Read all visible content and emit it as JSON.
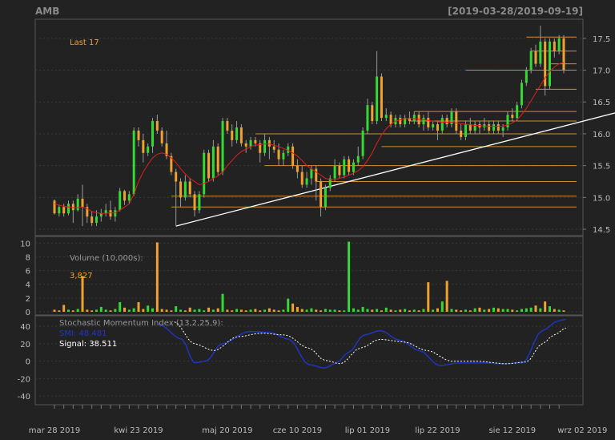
{
  "title": "AMB",
  "date_range": "[2019-03-28/2019-09-19]",
  "colors": {
    "background": "#222222",
    "grid": "#3a3a3a",
    "up": "#35d935",
    "down": "#f0a030",
    "last": "#f0a030",
    "sma": "#e0201a",
    "trendline": "#ffffff",
    "smi": "#1f35c8",
    "signal": "#ffffff",
    "volume_label": "#f0a030"
  },
  "chart_data": [
    {
      "type": "candlestick",
      "panel": "price",
      "last_label": "Last 17",
      "y_ticks": [
        "17.5",
        "17.0",
        "16.5",
        "16.0",
        "15.5",
        "15.0",
        "14.5"
      ],
      "ylim": [
        14.4,
        17.8
      ],
      "x_tick_labels": [
        "mar 28 2019",
        "kwi 23 2019",
        "maj 20 2019",
        "cze 10 2019",
        "lip 01 2019",
        "lip 22 2019",
        "sie 12 2019",
        "wrz 02 2019"
      ],
      "x_tick_index": [
        0,
        18,
        37,
        52,
        67,
        82,
        98,
        113
      ],
      "candles": [
        [
          14.95,
          14.75,
          14.97,
          14.73
        ],
        [
          14.75,
          14.85,
          14.88,
          14.7
        ],
        [
          14.85,
          14.75,
          14.9,
          14.7
        ],
        [
          14.75,
          14.9,
          14.95,
          14.72
        ],
        [
          14.9,
          14.8,
          14.95,
          14.6
        ],
        [
          14.8,
          14.98,
          15.05,
          14.78
        ],
        [
          14.98,
          14.85,
          15.2,
          14.55
        ],
        [
          14.85,
          14.7,
          14.9,
          14.6
        ],
        [
          14.7,
          14.6,
          14.78,
          14.55
        ],
        [
          14.6,
          14.7,
          14.8,
          14.55
        ],
        [
          14.7,
          14.75,
          14.82,
          14.62
        ],
        [
          14.75,
          14.8,
          14.9,
          14.7
        ],
        [
          14.8,
          14.7,
          14.95,
          14.65
        ],
        [
          14.7,
          14.8,
          14.85,
          14.62
        ],
        [
          14.8,
          15.1,
          15.15,
          14.78
        ],
        [
          15.1,
          14.95,
          15.12,
          14.88
        ],
        [
          14.95,
          15.05,
          15.1,
          14.9
        ],
        [
          15.05,
          16.05,
          16.1,
          15.02
        ],
        [
          16.05,
          15.9,
          16.1,
          15.8
        ],
        [
          15.9,
          15.7,
          16.0,
          15.55
        ],
        [
          15.7,
          15.8,
          15.85,
          15.65
        ],
        [
          15.8,
          16.2,
          16.25,
          15.7
        ],
        [
          16.2,
          16.05,
          16.3,
          16.0
        ],
        [
          16.05,
          15.85,
          16.1,
          15.8
        ],
        [
          15.85,
          15.65,
          16.05,
          15.6
        ],
        [
          15.65,
          15.4,
          15.7,
          15.35
        ],
        [
          15.4,
          15.25,
          15.45,
          14.55
        ],
        [
          15.25,
          15.0,
          15.3,
          14.85
        ],
        [
          15.0,
          15.25,
          15.35,
          14.95
        ],
        [
          15.25,
          15.05,
          15.3,
          15.0
        ],
        [
          15.05,
          14.8,
          15.1,
          14.7
        ],
        [
          14.8,
          15.05,
          15.1,
          14.75
        ],
        [
          15.05,
          15.7,
          15.75,
          15.0
        ],
        [
          15.7,
          15.3,
          15.75,
          15.25
        ],
        [
          15.3,
          15.8,
          15.9,
          15.25
        ],
        [
          15.8,
          15.4,
          15.85,
          15.35
        ],
        [
          15.4,
          16.2,
          16.25,
          15.35
        ],
        [
          16.2,
          16.05,
          16.25,
          16.0
        ],
        [
          16.05,
          15.9,
          16.15,
          15.8
        ],
        [
          15.9,
          16.1,
          16.2,
          15.85
        ],
        [
          16.1,
          15.85,
          16.15,
          15.8
        ],
        [
          15.85,
          15.8,
          15.9,
          15.7
        ],
        [
          15.8,
          15.9,
          15.95,
          15.75
        ],
        [
          15.9,
          15.85,
          15.95,
          15.8
        ],
        [
          15.85,
          15.7,
          15.9,
          15.55
        ],
        [
          15.7,
          15.9,
          16.0,
          15.65
        ],
        [
          15.9,
          15.8,
          15.95,
          15.6
        ],
        [
          15.8,
          15.75,
          15.9,
          15.7
        ],
        [
          15.75,
          15.6,
          15.85,
          15.5
        ],
        [
          15.6,
          15.7,
          15.75,
          15.5
        ],
        [
          15.7,
          15.8,
          15.85,
          15.65
        ],
        [
          15.8,
          15.5,
          15.85,
          15.45
        ],
        [
          15.5,
          15.4,
          15.6,
          15.3
        ],
        [
          15.4,
          15.2,
          15.5,
          15.15
        ],
        [
          15.2,
          15.3,
          15.4,
          15.15
        ],
        [
          15.3,
          15.45,
          15.5,
          15.2
        ],
        [
          15.45,
          15.25,
          15.5,
          14.95
        ],
        [
          15.25,
          14.85,
          15.3,
          14.7
        ],
        [
          14.85,
          15.15,
          15.2,
          14.8
        ],
        [
          15.15,
          15.3,
          15.35,
          15.1
        ],
        [
          15.3,
          15.5,
          15.6,
          15.25
        ],
        [
          15.5,
          15.35,
          15.55,
          15.3
        ],
        [
          15.35,
          15.6,
          15.65,
          15.3
        ],
        [
          15.6,
          15.4,
          15.65,
          15.35
        ],
        [
          15.4,
          15.55,
          15.6,
          15.35
        ],
        [
          15.55,
          15.65,
          15.8,
          15.5
        ],
        [
          15.65,
          16.05,
          16.1,
          15.6
        ],
        [
          16.05,
          16.45,
          16.55,
          16.0
        ],
        [
          16.45,
          16.2,
          16.5,
          16.15
        ],
        [
          16.2,
          16.9,
          17.3,
          16.15
        ],
        [
          16.9,
          16.25,
          16.95,
          16.2
        ],
        [
          16.25,
          16.3,
          16.4,
          16.2
        ],
        [
          16.3,
          16.15,
          16.35,
          16.1
        ],
        [
          16.15,
          16.25,
          16.3,
          16.1
        ],
        [
          16.25,
          16.15,
          16.3,
          16.1
        ],
        [
          16.15,
          16.25,
          16.3,
          16.1
        ],
        [
          16.25,
          16.2,
          16.35,
          16.15
        ],
        [
          16.2,
          16.3,
          16.35,
          16.15
        ],
        [
          16.3,
          16.15,
          16.35,
          16.1
        ],
        [
          16.15,
          16.25,
          16.3,
          16.05
        ],
        [
          16.25,
          16.1,
          16.35,
          16.05
        ],
        [
          16.1,
          16.15,
          16.2,
          16.05
        ],
        [
          16.15,
          16.05,
          16.2,
          15.9
        ],
        [
          16.05,
          16.25,
          16.3,
          16.0
        ],
        [
          16.25,
          16.15,
          16.3,
          16.1
        ],
        [
          16.15,
          16.35,
          16.4,
          16.1
        ],
        [
          16.35,
          16.05,
          16.4,
          16.0
        ],
        [
          16.05,
          15.95,
          16.15,
          15.9
        ],
        [
          15.95,
          16.15,
          16.2,
          15.9
        ],
        [
          16.15,
          16.05,
          16.25,
          16.0
        ],
        [
          16.05,
          16.15,
          16.2,
          16.0
        ],
        [
          16.15,
          16.1,
          16.2,
          16.0
        ],
        [
          16.1,
          16.15,
          16.25,
          16.05
        ],
        [
          16.15,
          16.05,
          16.2,
          16.0
        ],
        [
          16.05,
          16.15,
          16.2,
          16.0
        ],
        [
          16.15,
          16.05,
          16.2,
          16.0
        ],
        [
          16.05,
          16.1,
          16.15,
          15.95
        ],
        [
          16.1,
          16.3,
          16.35,
          16.05
        ],
        [
          16.3,
          16.25,
          16.4,
          16.2
        ],
        [
          16.25,
          16.45,
          16.5,
          16.2
        ],
        [
          16.45,
          16.8,
          16.85,
          16.4
        ],
        [
          16.8,
          17.0,
          17.05,
          16.75
        ],
        [
          17.0,
          17.3,
          17.35,
          16.95
        ],
        [
          17.3,
          17.1,
          17.4,
          17.05
        ],
        [
          17.1,
          17.45,
          17.7,
          17.05
        ],
        [
          17.45,
          16.75,
          17.5,
          16.6
        ],
        [
          16.75,
          17.45,
          17.5,
          16.7
        ],
        [
          17.45,
          17.3,
          17.5,
          17.2
        ],
        [
          17.3,
          17.5,
          17.55,
          17.25
        ],
        [
          17.5,
          17.0,
          17.55,
          16.95
        ]
      ],
      "sma": [
        14.9,
        14.88,
        14.86,
        14.85,
        14.84,
        14.84,
        14.85,
        14.82,
        14.78,
        14.76,
        14.75,
        14.75,
        14.76,
        14.76,
        14.8,
        14.85,
        14.9,
        15.05,
        15.25,
        15.4,
        15.52,
        15.62,
        15.68,
        15.7,
        15.68,
        15.62,
        15.55,
        15.45,
        15.37,
        15.3,
        15.25,
        15.2,
        15.22,
        15.25,
        15.3,
        15.34,
        15.4,
        15.5,
        15.58,
        15.66,
        15.72,
        15.76,
        15.8,
        15.82,
        15.83,
        15.84,
        15.84,
        15.82,
        15.8,
        15.77,
        15.74,
        15.7,
        15.65,
        15.58,
        15.5,
        15.45,
        15.4,
        15.35,
        15.3,
        15.28,
        15.28,
        15.3,
        15.32,
        15.35,
        15.38,
        15.42,
        15.48,
        15.58,
        15.7,
        15.85,
        15.98,
        16.08,
        16.15,
        16.2,
        16.22,
        16.24,
        16.24,
        16.24,
        16.23,
        16.22,
        16.21,
        16.2,
        16.19,
        16.18,
        16.18,
        16.18,
        16.17,
        16.16,
        16.15,
        16.14,
        16.13,
        16.13,
        16.12,
        16.12,
        16.12,
        16.12,
        16.12,
        16.14,
        16.17,
        16.22,
        16.3,
        16.4,
        16.52,
        16.64,
        16.76,
        16.88,
        16.98,
        17.05,
        17.1,
        17.12
      ],
      "trendline": {
        "from": [
          26,
          14.55
        ],
        "to": [
          117,
          16.33
        ]
      },
      "support_resistance": [
        {
          "level": 17.52,
          "from": 101
        },
        {
          "level": 17.3,
          "from": 102
        },
        {
          "level": 17.1,
          "from": 106
        },
        {
          "level": 17.0,
          "from": 88
        },
        {
          "level": 16.7,
          "from": 103
        },
        {
          "level": 16.35,
          "from": 77
        },
        {
          "level": 16.2,
          "from": 76
        },
        {
          "level": 16.0,
          "from": 43
        },
        {
          "level": 15.8,
          "from": 70
        },
        {
          "level": 15.5,
          "from": 45
        },
        {
          "level": 15.25,
          "from": 56
        },
        {
          "level": 15.02,
          "from": 25
        },
        {
          "level": 14.85,
          "from": 25
        }
      ]
    },
    {
      "type": "bar",
      "panel": "volume",
      "label": "Volume (10,000s):",
      "last_value": "3,827",
      "y_ticks": [
        "10",
        "8",
        "6",
        "4",
        "2",
        "0"
      ],
      "ylim": [
        0,
        10.5
      ],
      "values": [
        0.3,
        0.2,
        1.0,
        0.3,
        0.2,
        0.4,
        5.2,
        0.3,
        0.2,
        0.3,
        0.7,
        0.3,
        0.2,
        0.4,
        1.4,
        0.6,
        0.3,
        0.5,
        1.4,
        0.4,
        0.9,
        0.5,
        10.1,
        0.4,
        0.3,
        0.2,
        0.8,
        0.3,
        0.2,
        0.6,
        0.3,
        0.4,
        0.2,
        0.6,
        0.3,
        0.5,
        2.6,
        0.3,
        0.2,
        0.4,
        0.3,
        0.2,
        0.3,
        0.4,
        0.2,
        0.3,
        0.5,
        0.3,
        0.2,
        0.3,
        1.9,
        1.2,
        0.7,
        0.4,
        0.3,
        0.5,
        0.3,
        0.2,
        0.4,
        0.3,
        0.3,
        0.2,
        0.2,
        10.2,
        0.5,
        0.3,
        0.7,
        0.4,
        0.3,
        0.4,
        0.2,
        0.6,
        0.3,
        0.2,
        0.3,
        0.4,
        0.2,
        0.3,
        0.2,
        0.4,
        4.3,
        0.3,
        0.5,
        1.5,
        4.5,
        0.4,
        0.3,
        0.2,
        0.3,
        0.2,
        0.5,
        0.6,
        0.3,
        0.4,
        0.6,
        0.5,
        0.4,
        0.4,
        0.3,
        0.2,
        0.4,
        0.5,
        0.6,
        0.9,
        0.5,
        1.5,
        0.8,
        0.4,
        0.3,
        0.2
      ],
      "up": [
        0,
        0,
        0,
        1,
        0,
        1,
        0,
        0,
        0,
        1,
        1,
        1,
        0,
        1,
        1,
        0,
        1,
        1,
        0,
        0,
        1,
        1,
        0,
        0,
        0,
        0,
        1,
        1,
        0,
        0,
        1,
        1,
        1,
        0,
        1,
        0,
        1,
        0,
        0,
        1,
        0,
        0,
        1,
        0,
        0,
        1,
        0,
        0,
        0,
        1,
        1,
        0,
        0,
        0,
        1,
        1,
        0,
        0,
        1,
        1,
        1,
        0,
        1,
        1,
        1,
        1,
        1,
        1,
        0,
        1,
        0,
        1,
        0,
        1,
        0,
        1,
        0,
        1,
        0,
        1,
        0,
        1,
        0,
        1,
        0,
        1,
        0,
        0,
        1,
        0,
        1,
        0,
        1,
        0,
        1,
        0,
        1,
        1,
        0,
        1,
        1,
        1,
        1,
        0,
        1,
        0,
        1,
        0,
        1,
        0
      ]
    },
    {
      "type": "line",
      "panel": "indicator",
      "label": "Stochastic Momentum Index (13,2,25,9):",
      "series": [
        {
          "name": "SMI: 48.481",
          "values": []
        },
        {
          "name": "Signal: 38.511",
          "values": []
        }
      ],
      "y_ticks": [
        "40",
        "20",
        "0",
        "-20",
        "-40"
      ],
      "ylim": [
        -50,
        52
      ]
    }
  ]
}
